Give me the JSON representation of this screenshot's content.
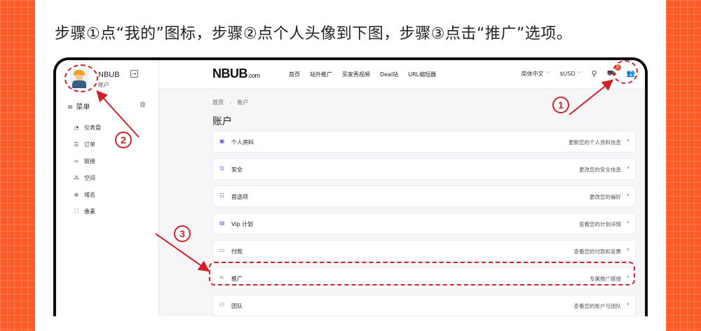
{
  "instruction": "步骤①点“我的”图标，步骤②点个人头像到下图，步骤③点击“推广”选项。",
  "sidebar": {
    "brand_name": "NBUB",
    "brand_sub": "账户",
    "menu_title": "菜单",
    "items": [
      {
        "icon": "dashboard-icon",
        "label": "仪表盘"
      },
      {
        "icon": "list-icon",
        "label": "订单"
      },
      {
        "icon": "link-icon",
        "label": "链接"
      },
      {
        "icon": "space-icon",
        "label": "空间"
      },
      {
        "icon": "globe-icon",
        "label": "域名"
      },
      {
        "icon": "pixel-icon",
        "label": "像素"
      }
    ]
  },
  "header": {
    "logo": "NBUB",
    "logo_suffix": ".com",
    "nav": [
      "首页",
      "站外推广",
      "买家秀视频",
      "Deal站",
      "URL缩短器"
    ],
    "language": "简体中文",
    "currency": "$USD",
    "cart_count": "0"
  },
  "main": {
    "breadcrumb": [
      "首页",
      "账户"
    ],
    "title": "账户",
    "cards": [
      {
        "icon": "profile-icon",
        "label": "个人资料",
        "desc": "更新您的个人资料信息"
      },
      {
        "icon": "lock-icon",
        "label": "安全",
        "desc": "更改您的安全信息"
      },
      {
        "icon": "sliders-icon",
        "label": "首选项",
        "desc": "更改您的偏好"
      },
      {
        "icon": "calendar-icon",
        "label": "Vip 计划",
        "desc": "查看您的计划详情"
      },
      {
        "icon": "card-icon",
        "label": "付款",
        "desc": "查看您的付款和发票"
      },
      {
        "icon": "share-icon",
        "label": "推广",
        "desc": "专属推广链接"
      },
      {
        "icon": "team-icon",
        "label": "团队",
        "desc": "查看您的账户与团队"
      }
    ]
  },
  "annotations": {
    "step1": "1",
    "step2": "2",
    "step3": "3",
    "color": "#d1202a"
  }
}
